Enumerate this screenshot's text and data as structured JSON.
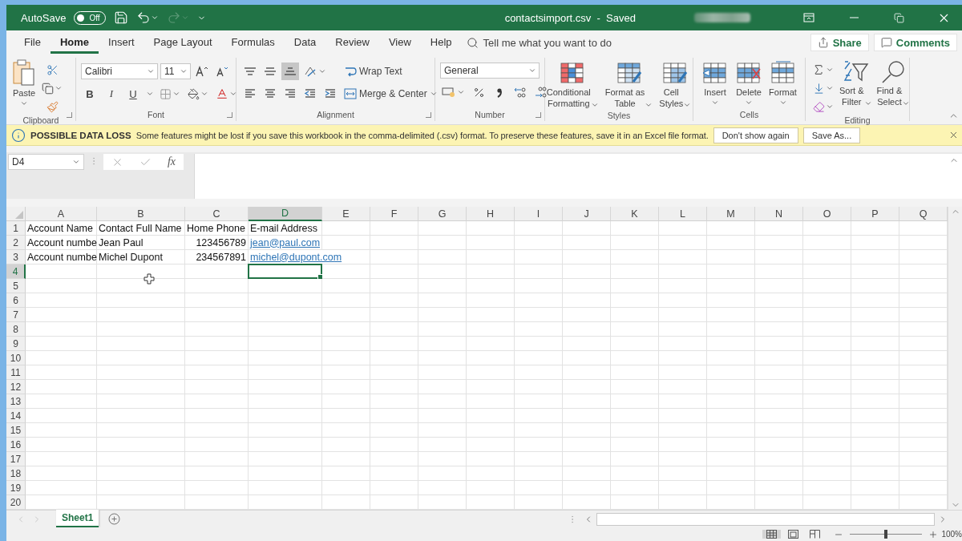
{
  "title_bar": {
    "autosave_label": "AutoSave",
    "autosave_on": false,
    "autosave_state": "Off",
    "document_title": "contactsimport.csv  -  Saved"
  },
  "menu_tabs": [
    {
      "label": "File",
      "selected": false
    },
    {
      "label": "Home",
      "selected": true
    },
    {
      "label": "Insert",
      "selected": false
    },
    {
      "label": "Page Layout",
      "selected": false
    },
    {
      "label": "Formulas",
      "selected": false
    },
    {
      "label": "Data",
      "selected": false
    },
    {
      "label": "Review",
      "selected": false
    },
    {
      "label": "View",
      "selected": false
    },
    {
      "label": "Help",
      "selected": false
    }
  ],
  "search": {
    "placeholder": "Tell me what you want to do"
  },
  "share_button": "Share",
  "comments_button": "Comments",
  "ribbon": {
    "groups": [
      {
        "kind": "clipboard",
        "label": "Clipboard",
        "paste_label": "Paste"
      },
      {
        "kind": "font",
        "label": "Font",
        "font_name": "Calibri",
        "font_size": "11",
        "bold": "B",
        "italic": "I",
        "underline": "U"
      },
      {
        "kind": "alignment",
        "label": "Alignment",
        "vertical_align": [
          {
            "kind": "top",
            "selected": false
          },
          {
            "kind": "middle",
            "selected": false
          },
          {
            "kind": "bottom",
            "selected": true
          }
        ],
        "wrap_text": "Wrap Text",
        "merge_center": "Merge & Center"
      },
      {
        "kind": "number",
        "label": "Number",
        "format": "General"
      },
      {
        "kind": "large",
        "label": "Styles",
        "buttons": [
          {
            "kind": "conditional",
            "label": "Conditional\nFormatting"
          },
          {
            "kind": "table",
            "label": "Format as\nTable"
          },
          {
            "kind": "styles",
            "label": "Cell\nStyles"
          }
        ]
      },
      {
        "kind": "large",
        "label": "Cells",
        "buttons": [
          {
            "kind": "insert",
            "label": "Insert"
          },
          {
            "kind": "delete",
            "label": "Delete"
          },
          {
            "kind": "format",
            "label": "Format"
          }
        ]
      },
      {
        "kind": "editing",
        "label": "Editing",
        "buttons": [
          {
            "kind": "sort",
            "label": "Sort &\nFilter"
          },
          {
            "kind": "find",
            "label": "Find &\nSelect"
          }
        ]
      }
    ]
  },
  "info_bar": {
    "title": "POSSIBLE DATA LOSS",
    "message": "Some features might be lost if you save this workbook in the comma-delimited (.csv) format. To preserve these features, save it in an Excel file format.",
    "buttons": [
      "Don't show again",
      "Save As..."
    ]
  },
  "formula_bar": {
    "name_box": "D4",
    "function_label": "fx"
  },
  "sheet": {
    "columns": [
      {
        "label": "A",
        "selected": false
      },
      {
        "label": "B",
        "selected": false
      },
      {
        "label": "C",
        "selected": false
      },
      {
        "label": "D",
        "selected": true
      },
      {
        "label": "E",
        "selected": false
      },
      {
        "label": "F",
        "selected": false
      },
      {
        "label": "G",
        "selected": false
      },
      {
        "label": "H",
        "selected": false
      },
      {
        "label": "I",
        "selected": false
      },
      {
        "label": "J",
        "selected": false
      },
      {
        "label": "K",
        "selected": false
      },
      {
        "label": "L",
        "selected": false
      },
      {
        "label": "M",
        "selected": false
      },
      {
        "label": "N",
        "selected": false
      },
      {
        "label": "O",
        "selected": false
      },
      {
        "label": "P",
        "selected": false
      },
      {
        "label": "Q",
        "selected": false
      }
    ],
    "rows": [
      {
        "label": "1",
        "selected": false,
        "cells": [
          {
            "kind": "text",
            "text": "Account Name"
          },
          {
            "kind": "text",
            "text": "Contact Full Name"
          },
          {
            "kind": "text",
            "text": "Home Phone"
          },
          {
            "kind": "text",
            "text": "E-mail Address"
          }
        ]
      },
      {
        "label": "2",
        "selected": false,
        "cells": [
          {
            "kind": "text",
            "text": "Account numbe"
          },
          {
            "kind": "text",
            "text": "Jean Paul"
          },
          {
            "kind": "number",
            "text": "123456789"
          },
          {
            "kind": "link",
            "text": "jean@paul.com"
          }
        ]
      },
      {
        "label": "3",
        "selected": false,
        "cells": [
          {
            "kind": "text",
            "text": "Account numbe"
          },
          {
            "kind": "text",
            "text": "Michel Dupont"
          },
          {
            "kind": "number",
            "text": "234567891"
          },
          {
            "kind": "link",
            "text": "michel@dupont.com"
          }
        ]
      },
      {
        "label": "4",
        "selected": true
      },
      {
        "label": "5",
        "selected": false
      },
      {
        "label": "6",
        "selected": false
      },
      {
        "label": "7",
        "selected": false
      },
      {
        "label": "8",
        "selected": false
      },
      {
        "label": "9",
        "selected": false
      },
      {
        "label": "10",
        "selected": false
      },
      {
        "label": "11",
        "selected": false
      },
      {
        "label": "12",
        "selected": false
      },
      {
        "label": "13",
        "selected": false
      },
      {
        "label": "14",
        "selected": false
      },
      {
        "label": "15",
        "selected": false
      },
      {
        "label": "16",
        "selected": false
      },
      {
        "label": "17",
        "selected": false
      },
      {
        "label": "18",
        "selected": false
      },
      {
        "label": "19",
        "selected": false
      },
      {
        "label": "20",
        "selected": false
      }
    ]
  },
  "sheet_tabs": [
    {
      "label": "Sheet1",
      "selected": true
    }
  ],
  "status_bar": {
    "views": [
      {
        "kind": "normal",
        "selected": true
      },
      {
        "kind": "page_layout",
        "selected": false
      },
      {
        "kind": "page_break",
        "selected": false
      }
    ],
    "zoom": {
      "level": 0.5,
      "label": "100%"
    }
  }
}
